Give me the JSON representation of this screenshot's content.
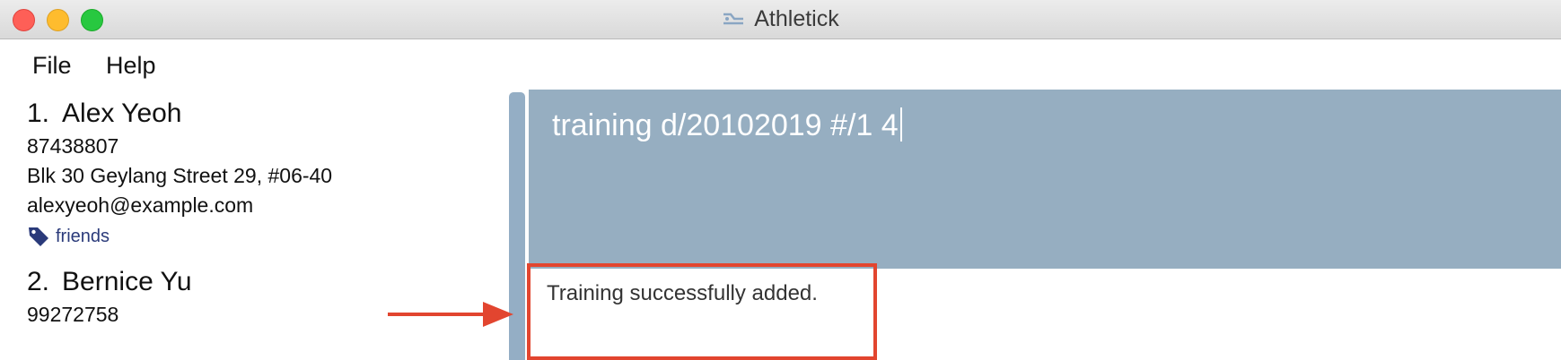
{
  "window": {
    "title": "Athletick",
    "icon": "athletick-app-icon"
  },
  "menu": {
    "items": [
      {
        "label": "File"
      },
      {
        "label": "Help"
      }
    ]
  },
  "person_list": {
    "persons": [
      {
        "index": "1.",
        "name": "Alex Yeoh",
        "phone": "87438807",
        "address": "Blk 30 Geylang Street 29, #06-40",
        "email": "alexyeoh@example.com",
        "tags": [
          "friends"
        ]
      },
      {
        "index": "2.",
        "name": "Bernice Yu",
        "phone": "99272758"
      }
    ]
  },
  "command_box": {
    "value": "training d/20102019 #/1 4"
  },
  "result_display": {
    "text": "Training successfully added."
  },
  "annotations": {
    "color": "#e2452f"
  },
  "colors": {
    "command_bg": "#96aec1",
    "tag_icon": "#2a3a7a"
  }
}
